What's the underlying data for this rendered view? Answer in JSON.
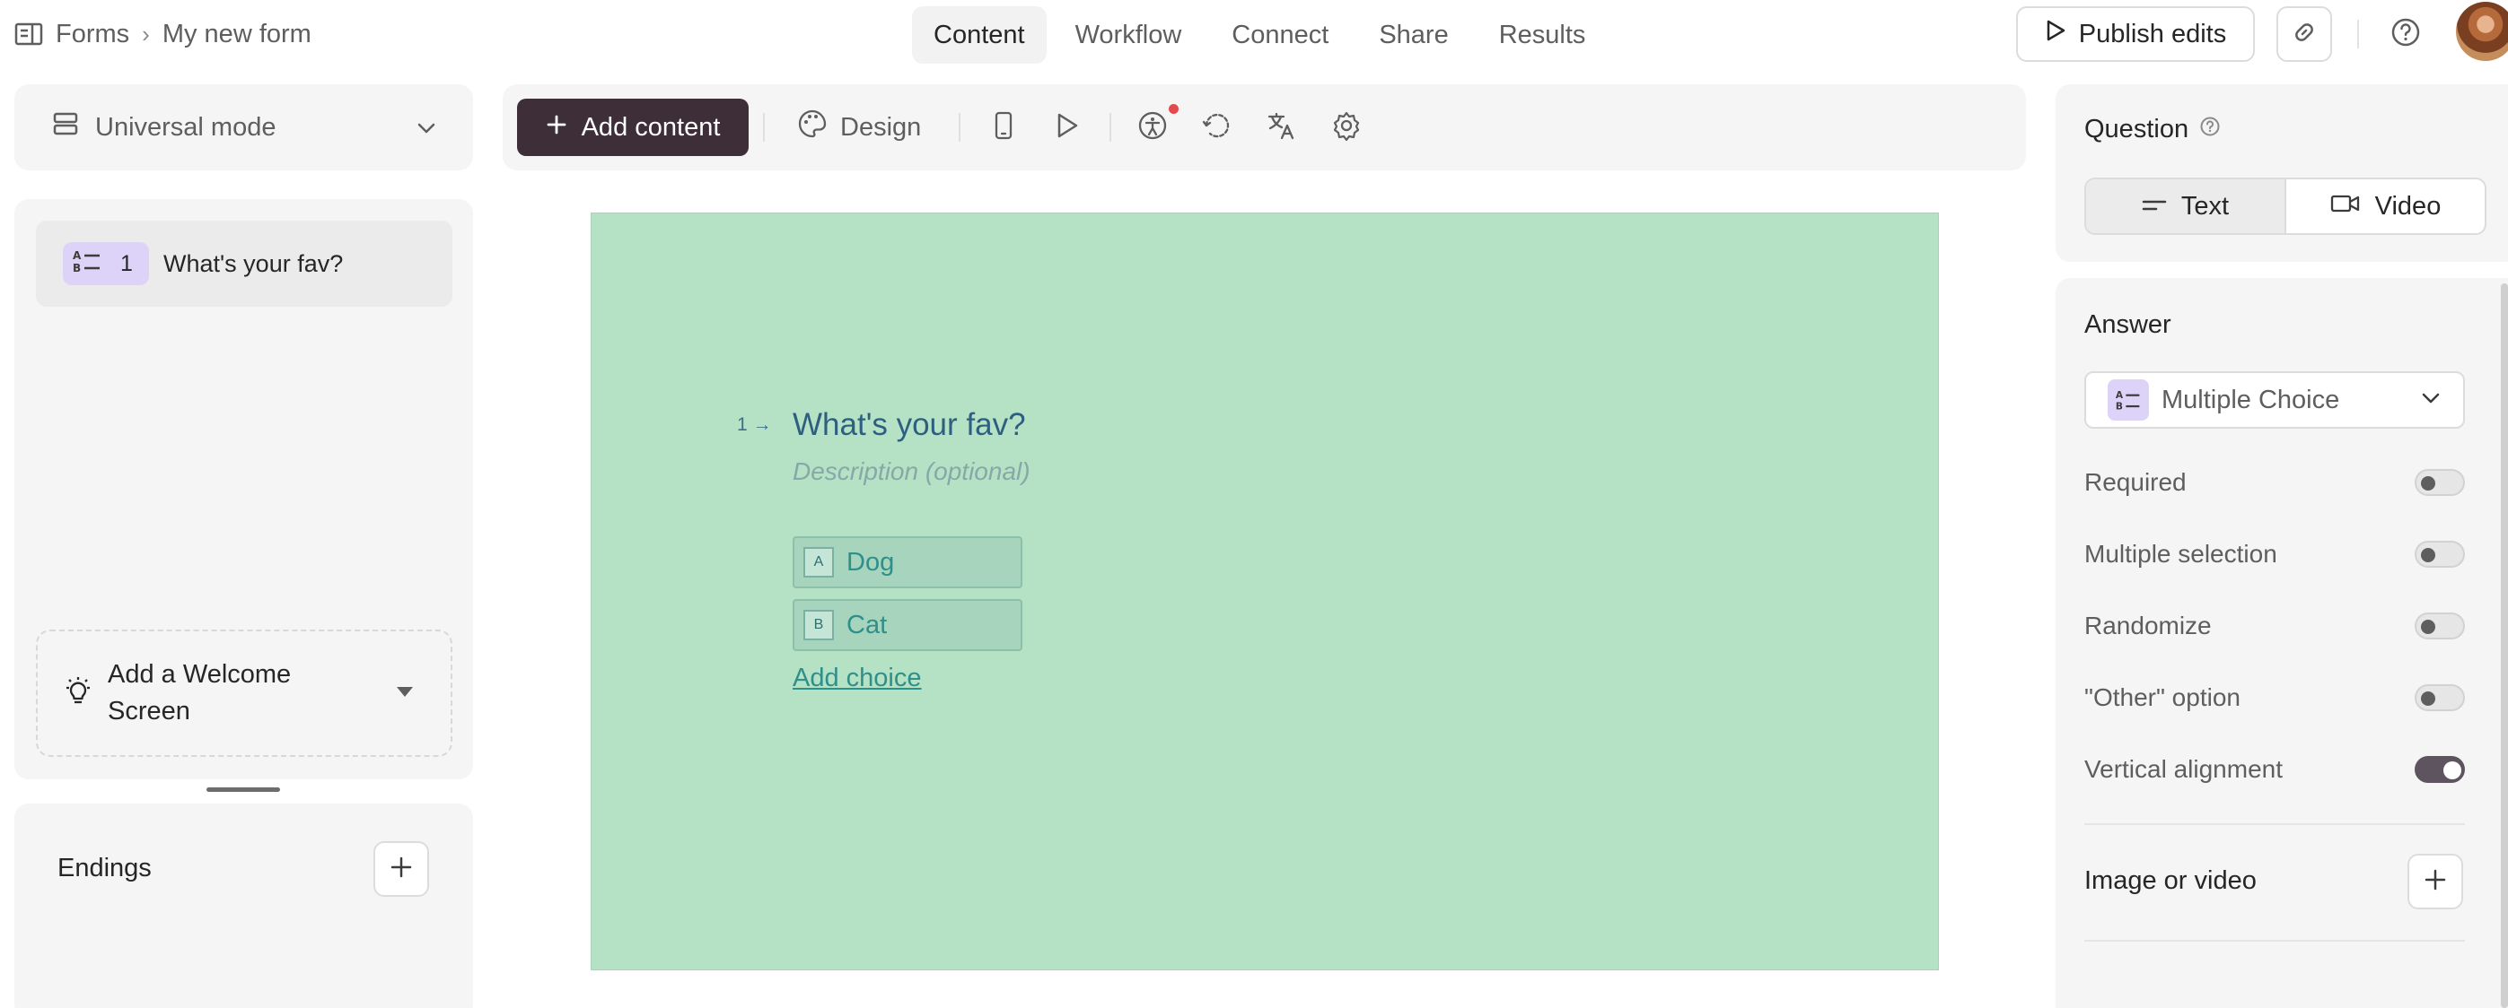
{
  "breadcrumb": {
    "root": "Forms",
    "current": "My new form"
  },
  "nav_tabs": [
    "Content",
    "Workflow",
    "Connect",
    "Share",
    "Results"
  ],
  "active_tab": "Content",
  "header": {
    "publish_label": "Publish edits"
  },
  "mode": {
    "label": "Universal mode"
  },
  "questions": [
    {
      "number": "1",
      "title": "What's your fav?",
      "icon": "multiple-choice-icon"
    }
  ],
  "welcome": {
    "label": "Add a Welcome Screen"
  },
  "endings": {
    "label": "Endings"
  },
  "toolbar": {
    "add_content": "Add content",
    "design": "Design"
  },
  "canvas": {
    "background": "#b5e2c4",
    "question_number": "1",
    "question_title": "What's your fav?",
    "description_placeholder": "Description (optional)",
    "choices": [
      {
        "key": "A",
        "label": "Dog"
      },
      {
        "key": "B",
        "label": "Cat"
      }
    ],
    "add_choice": "Add choice"
  },
  "question_panel": {
    "title": "Question",
    "options": [
      "Text",
      "Video"
    ],
    "selected": "Text"
  },
  "answer_panel": {
    "title": "Answer",
    "type": "Multiple Choice",
    "settings": [
      {
        "label": "Required",
        "on": false
      },
      {
        "label": "Multiple selection",
        "on": false
      },
      {
        "label": "Randomize",
        "on": false
      },
      {
        "label": "\"Other\" option",
        "on": false
      },
      {
        "label": "Vertical alignment",
        "on": true
      }
    ],
    "media_label": "Image or video"
  },
  "colors": {
    "accent": "#3d2e38",
    "badge": "#ddd3f8",
    "canvas": "#b5e2c4",
    "notification": "#e5484d"
  }
}
